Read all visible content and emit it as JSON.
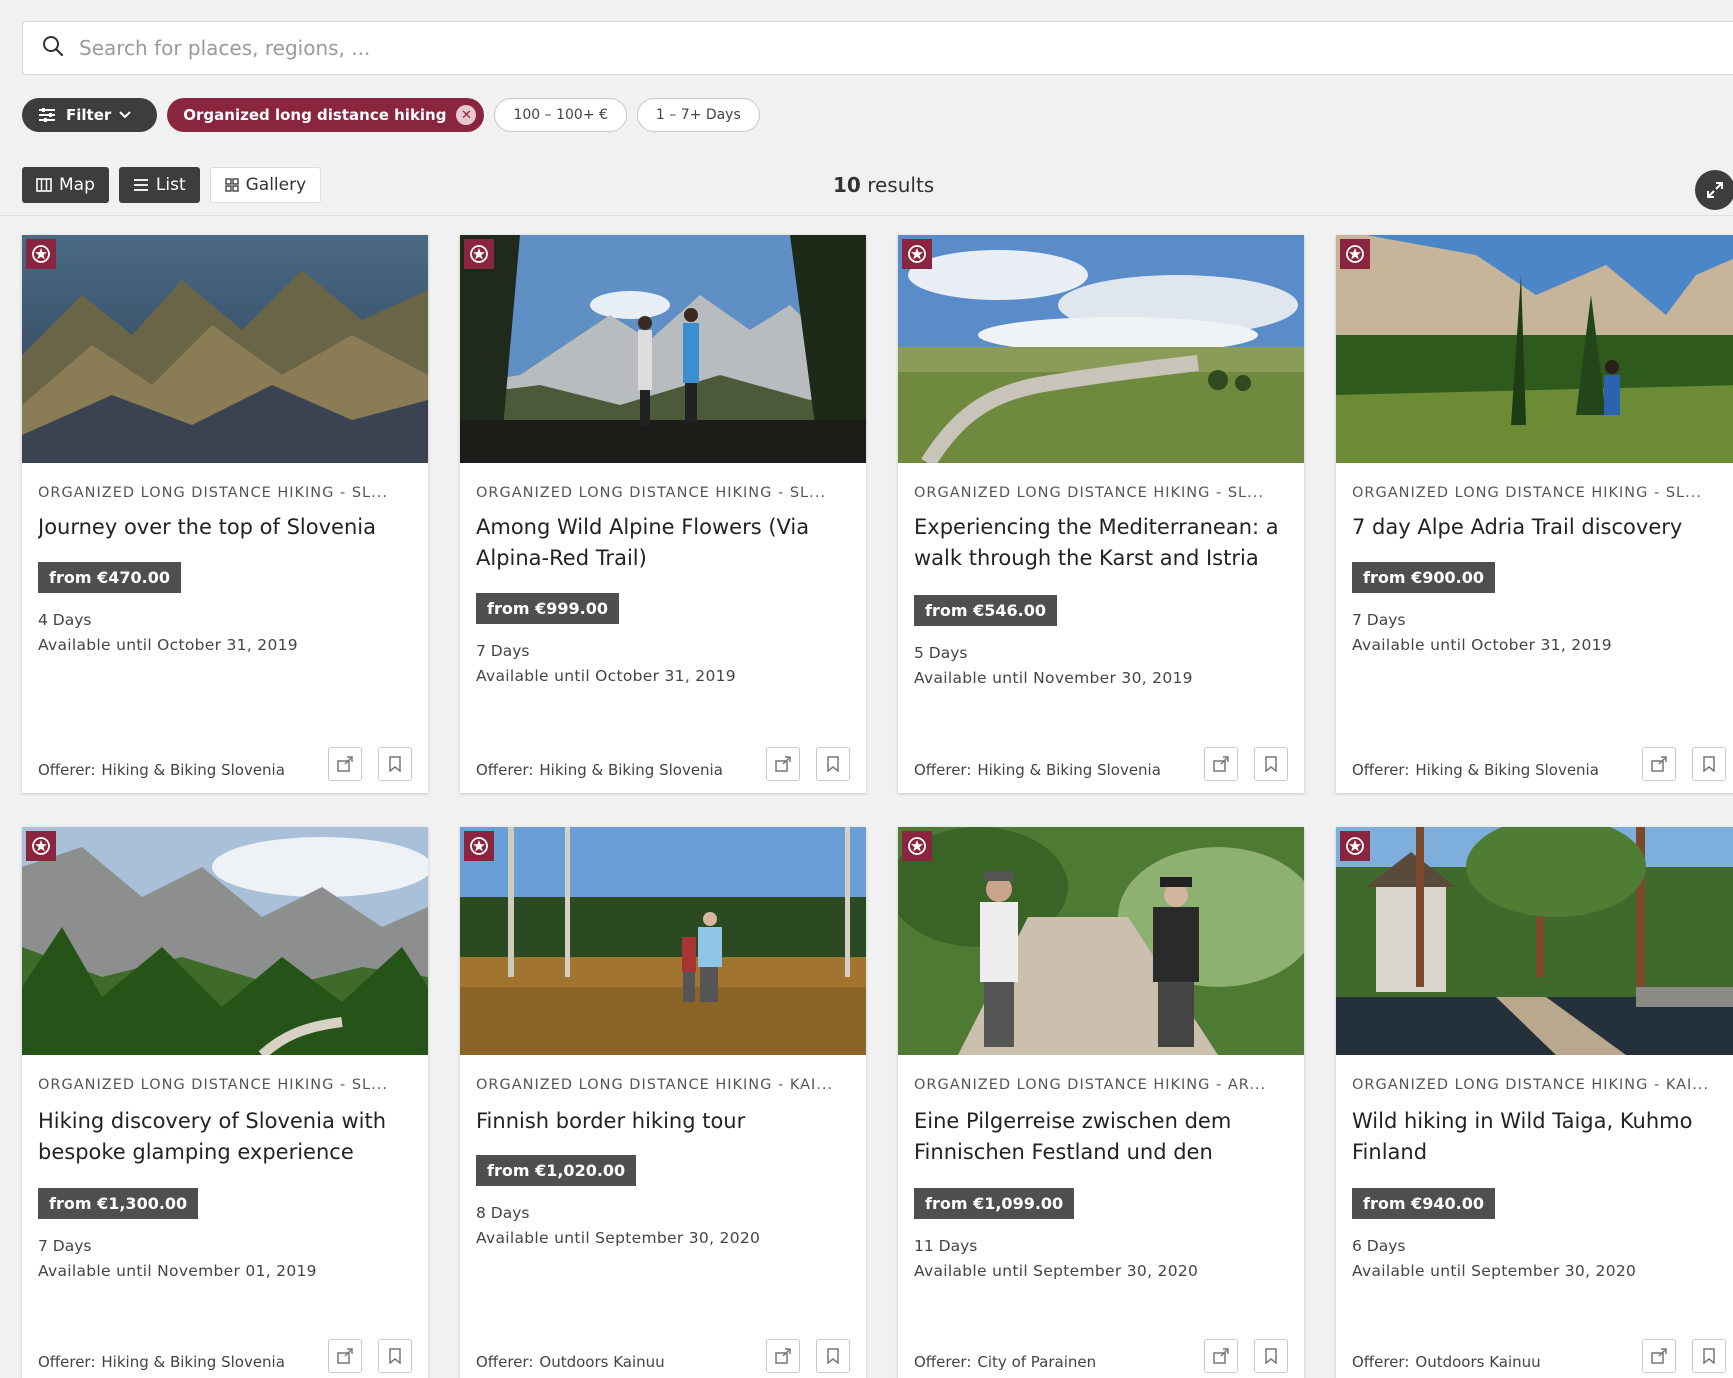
{
  "search": {
    "placeholder": "Search for places, regions, ..."
  },
  "chips": {
    "filter_label": "Filter",
    "active_label": "Organized long distance hiking",
    "price_label": "100 – 100+ €",
    "days_label": "1 – 7+ Days"
  },
  "views": {
    "map": "Map",
    "list": "List",
    "gallery": "Gallery"
  },
  "results": {
    "count": "10",
    "label": "results"
  },
  "offerer_label": "Offerer:",
  "colors": {
    "accent": "#8a2540",
    "dark": "#3d3d3d",
    "price_bg": "#4f4f4f"
  },
  "cards": [
    {
      "category": "ORGANIZED LONG DISTANCE HIKING - SL...",
      "title": "Journey over the top of Slovenia",
      "price": "from €470.00",
      "days": "4 Days",
      "available": "Available until October 31, 2019",
      "offerer": "Hiking & Biking Slovenia"
    },
    {
      "category": "ORGANIZED LONG DISTANCE HIKING - SL...",
      "title": "Among Wild Alpine Flowers (Via Alpina-Red Trail)",
      "price": "from €999.00",
      "days": "7 Days",
      "available": "Available until October 31, 2019",
      "offerer": "Hiking & Biking Slovenia"
    },
    {
      "category": "ORGANIZED LONG DISTANCE HIKING - SL...",
      "title": "Experiencing the Mediterranean: a walk through the Karst and Istria",
      "price": "from €546.00",
      "days": "5 Days",
      "available": "Available until November 30, 2019",
      "offerer": "Hiking & Biking Slovenia"
    },
    {
      "category": "ORGANIZED LONG DISTANCE HIKING - SL...",
      "title": "7 day Alpe Adria Trail discovery",
      "price": "from €900.00",
      "days": "7 Days",
      "available": "Available until October 31, 2019",
      "offerer": "Hiking & Biking Slovenia"
    },
    {
      "category": "ORGANIZED LONG DISTANCE HIKING - SL...",
      "title": "Hiking discovery of Slovenia with bespoke glamping experience",
      "price": "from €1,300.00",
      "days": "7 Days",
      "available": "Available until November 01, 2019",
      "offerer": "Hiking & Biking Slovenia"
    },
    {
      "category": "ORGANIZED LONG DISTANCE HIKING - KAI...",
      "title": "Finnish border hiking tour",
      "price": "from €1,020.00",
      "days": "8 Days",
      "available": "Available until September 30, 2020",
      "offerer": "Outdoors Kainuu"
    },
    {
      "category": "ORGANIZED LONG DISTANCE HIKING - AR...",
      "title": "Eine Pilgerreise zwischen dem Finnischen Festland und den",
      "price": "from €1,099.00",
      "days": "11 Days",
      "available": "Available until September 30, 2020",
      "offerer": "City of Parainen"
    },
    {
      "category": "ORGANIZED LONG DISTANCE HIKING - KAI...",
      "title": "Wild hiking in Wild Taiga, Kuhmo Finland",
      "price": "from €940.00",
      "days": "6 Days",
      "available": "Available until September 30, 2020",
      "offerer": "Outdoors Kainuu"
    }
  ]
}
